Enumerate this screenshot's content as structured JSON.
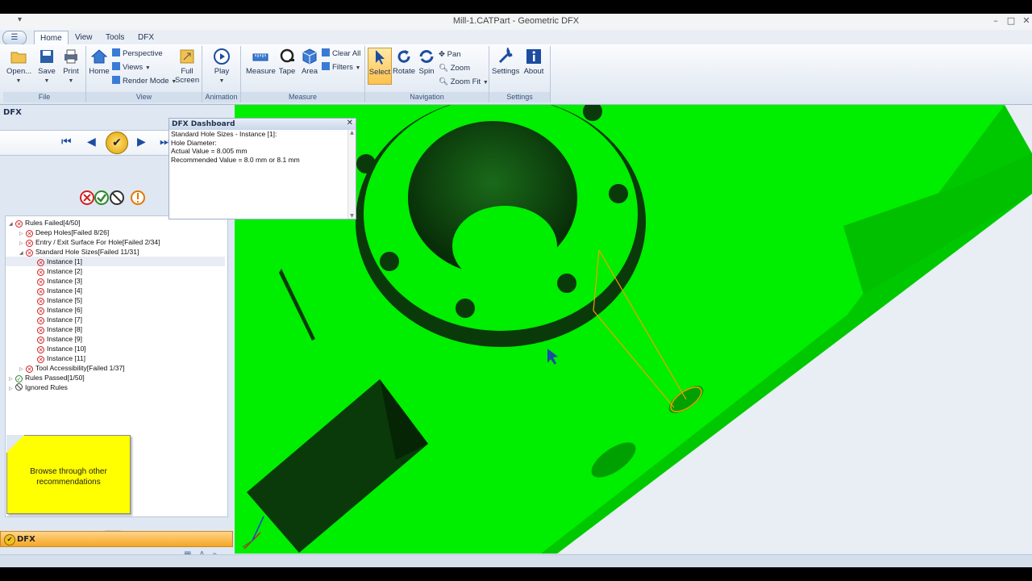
{
  "window": {
    "title": "Mill-1.CATPart - Geometric DFX",
    "quick_access": "▾",
    "controls": [
      "–",
      "□",
      "✕"
    ]
  },
  "menu": {
    "app_button": "☰",
    "tabs": [
      {
        "label": "Home",
        "active": true
      },
      {
        "label": "View",
        "active": false
      },
      {
        "label": "Tools",
        "active": false
      },
      {
        "label": "DFX",
        "active": false
      }
    ]
  },
  "ribbon": {
    "file": {
      "label": "File",
      "open": "Open...",
      "save": "Save",
      "print": "Print"
    },
    "view": {
      "label": "View",
      "home": "Home",
      "perspective": "Perspective",
      "views": "Views",
      "render_mode": "Render Mode",
      "full_screen_1": "Full",
      "full_screen_2": "Screen"
    },
    "animation": {
      "label": "Animation",
      "play": "Play"
    },
    "measure": {
      "label": "Measure",
      "measure": "Measure",
      "tape": "Tape",
      "area": "Area",
      "clear_all": "Clear All",
      "filters": "Filters"
    },
    "navigation": {
      "label": "Navigation",
      "select": "Select",
      "rotate": "Rotate",
      "spin": "Spin",
      "pan": "Pan",
      "zoom": "Zoom",
      "zoom_fit": "Zoom Fit"
    },
    "settings": {
      "label": "Settings",
      "settings": "Settings",
      "about": "About"
    }
  },
  "panel": {
    "title": "DFX",
    "tree": {
      "rules_failed": "Rules Failed[4/50]",
      "deep_holes": "Deep Holes[Failed 8/26]",
      "entry_exit": "Entry / Exit Surface For Hole[Failed 2/34]",
      "standard_hole_sizes": "Standard Hole Sizes[Failed 11/31]",
      "instances": [
        "Instance [1]",
        "Instance [2]",
        "Instance [3]",
        "Instance [4]",
        "Instance [5]",
        "Instance [6]",
        "Instance [7]",
        "Instance [8]",
        "Instance [9]",
        "Instance [10]",
        "Instance [11]"
      ],
      "tool_accessibility": "Tool Accessibility[Failed 1/37]",
      "rules_passed": "Rules Passed[1/50]",
      "ignored_rules": "Ignored Rules"
    },
    "note": "Browse through other recommendations",
    "dfx_bar": "DFX"
  },
  "dashboard": {
    "title": "DFX Dashboard",
    "lines": [
      "Standard Hole Sizes - Instance [1]:",
      "Hole Diameter:",
      "Actual Value = 8.005 mm",
      "Recommended Value = 8.0 mm  or 8.1 mm"
    ]
  },
  "colors": {
    "model": "#00ee00",
    "model_dark": "#0a3a0a",
    "highlight": "#f0a000",
    "ribbon_accent": "#1c4da0"
  }
}
